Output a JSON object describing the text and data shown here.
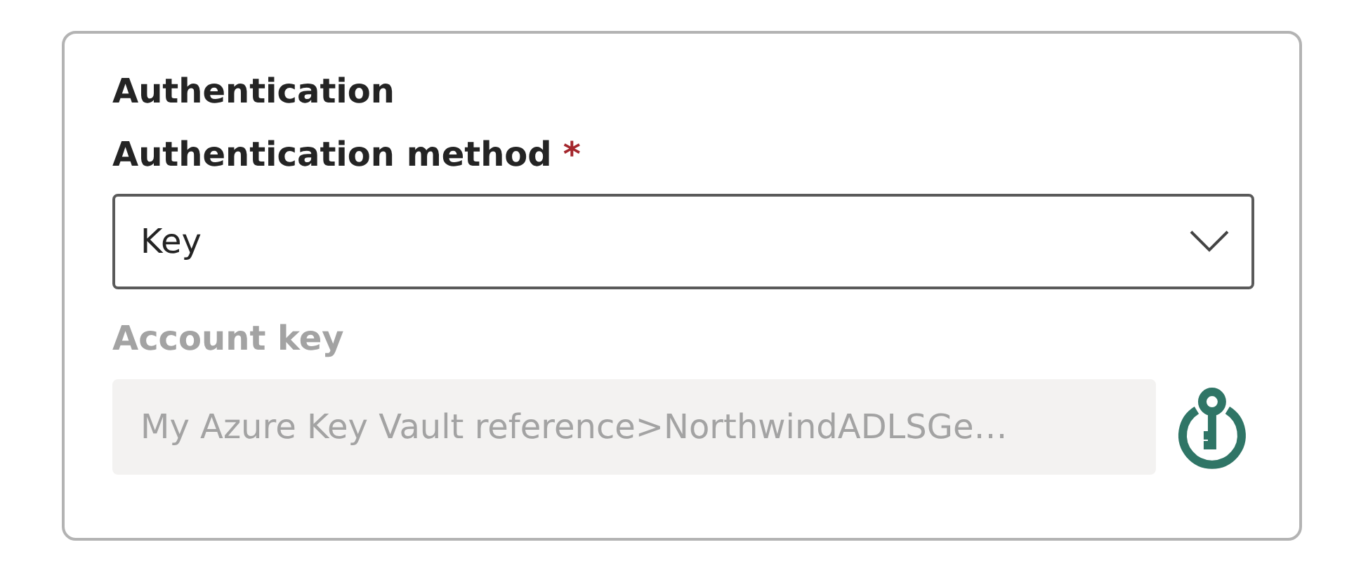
{
  "section": {
    "title": "Authentication"
  },
  "method": {
    "label": "Authentication method",
    "required_mark": "*",
    "value": "Key"
  },
  "account_key": {
    "label": "Account key",
    "disabled": true,
    "value": "My Azure Key Vault reference>NorthwindADLSGe…"
  }
}
